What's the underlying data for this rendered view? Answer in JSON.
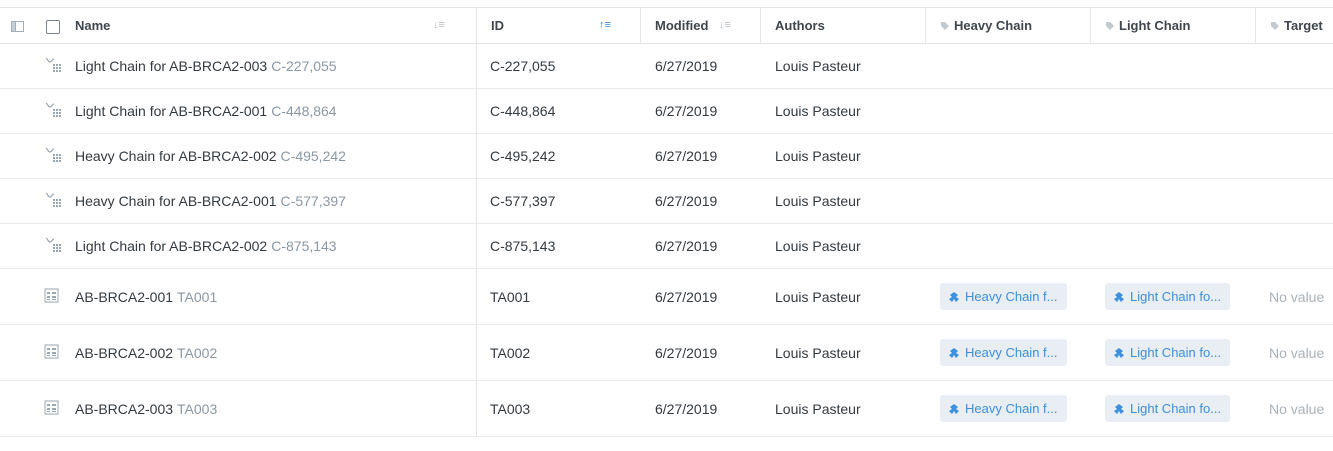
{
  "header": {
    "columns": {
      "name": "Name",
      "id": "ID",
      "modified": "Modified",
      "authors": "Authors",
      "heavy_chain": "Heavy Chain",
      "light_chain": "Light Chain",
      "target": "Target"
    },
    "sort_icon_inactive": "↓≡",
    "sort_icon_active": "↑≡"
  },
  "rows": [
    {
      "name": "Light Chain for AB-BRCA2-003",
      "name_id": "C-227,055",
      "id": "C-227,055",
      "modified": "6/27/2019",
      "author": "Louis Pasteur",
      "icon": "sequence-icon"
    },
    {
      "name": "Light Chain for AB-BRCA2-001",
      "name_id": "C-448,864",
      "id": "C-448,864",
      "modified": "6/27/2019",
      "author": "Louis Pasteur",
      "icon": "sequence-icon"
    },
    {
      "name": "Heavy Chain for AB-BRCA2-002",
      "name_id": "C-495,242",
      "id": "C-495,242",
      "modified": "6/27/2019",
      "author": "Louis Pasteur",
      "icon": "sequence-icon"
    },
    {
      "name": "Heavy Chain for AB-BRCA2-001",
      "name_id": "C-577,397",
      "id": "C-577,397",
      "modified": "6/27/2019",
      "author": "Louis Pasteur",
      "icon": "sequence-icon"
    },
    {
      "name": "Light Chain for AB-BRCA2-002",
      "name_id": "C-875,143",
      "id": "C-875,143",
      "modified": "6/27/2019",
      "author": "Louis Pasteur",
      "icon": "sequence-icon"
    },
    {
      "name": "AB-BRCA2-001",
      "name_id": "TA001",
      "id": "TA001",
      "modified": "6/27/2019",
      "author": "Louis Pasteur",
      "icon": "entity-table-icon",
      "heavy_chain": "Heavy Chain f...",
      "light_chain": "Light Chain fo...",
      "target": "No value"
    },
    {
      "name": "AB-BRCA2-002",
      "name_id": "TA002",
      "id": "TA002",
      "modified": "6/27/2019",
      "author": "Louis Pasteur",
      "icon": "entity-table-icon",
      "heavy_chain": "Heavy Chain f...",
      "light_chain": "Light Chain fo...",
      "target": "No value"
    },
    {
      "name": "AB-BRCA2-003",
      "name_id": "TA003",
      "id": "TA003",
      "modified": "6/27/2019",
      "author": "Louis Pasteur",
      "icon": "entity-table-icon",
      "heavy_chain": "Heavy Chain f...",
      "light_chain": "Light Chain fo...",
      "target": "No value"
    }
  ],
  "colors": {
    "accent": "#3d8fe0",
    "chip_bg": "#e8eef4",
    "muted": "#8a98a5"
  }
}
